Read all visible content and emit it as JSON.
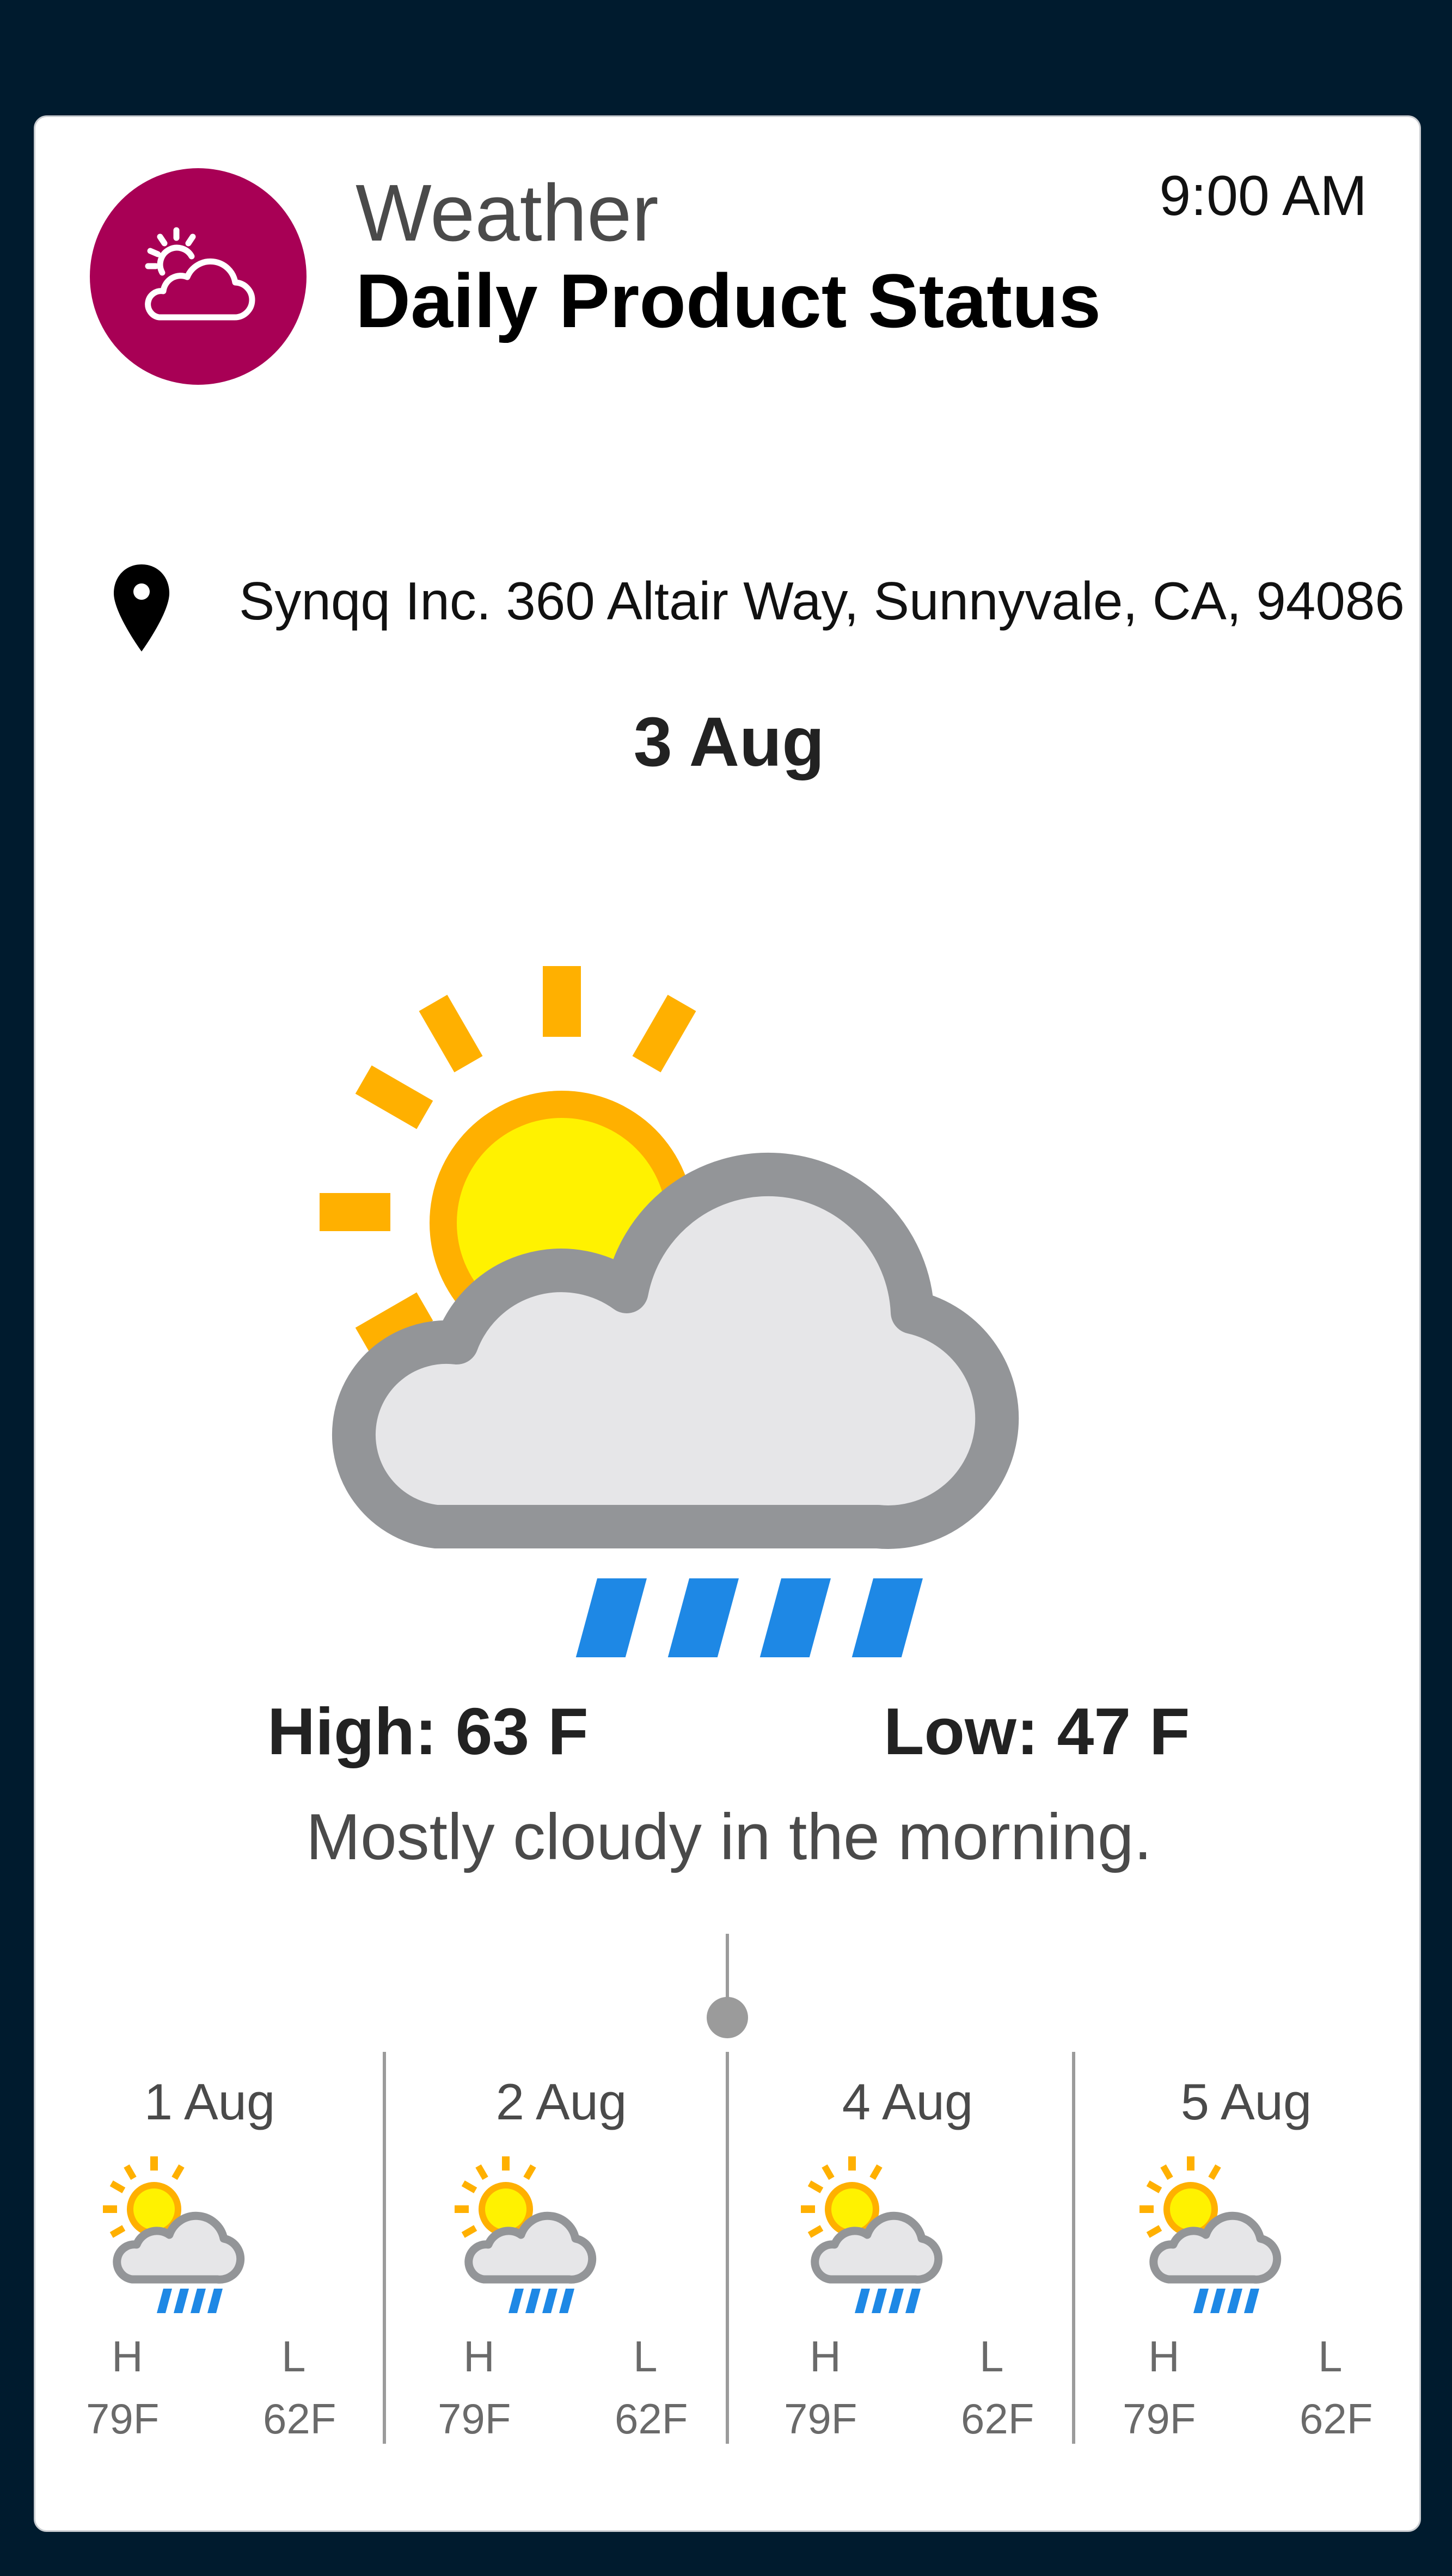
{
  "header": {
    "title": "Weather",
    "subtitle": "Daily Product Status",
    "time": "9:00 AM",
    "icon": "partly-sunny-cloud-icon",
    "brand_color": "#a80055"
  },
  "location": {
    "icon": "map-pin-icon",
    "address": "Synqq Inc. 360 Altair Way, Sunnyvale, CA, 94086"
  },
  "today": {
    "date": "3 Aug",
    "icon": "partly-cloudy-rain-icon",
    "high": "High: 63 F",
    "low": "Low: 47 F",
    "description": "Mostly cloudy in the morning."
  },
  "forecast": [
    {
      "date": "1 Aug",
      "icon": "partly-cloudy-rain-icon",
      "h_label": "H",
      "l_label": "L",
      "high": "79F",
      "low": "62F"
    },
    {
      "date": "2 Aug",
      "icon": "partly-cloudy-rain-icon",
      "h_label": "H",
      "l_label": "L",
      "high": "79F",
      "low": "62F"
    },
    {
      "date": "4 Aug",
      "icon": "partly-cloudy-rain-icon",
      "h_label": "H",
      "l_label": "L",
      "high": "79F",
      "low": "62F"
    },
    {
      "date": "5 Aug",
      "icon": "partly-cloudy-rain-icon",
      "h_label": "H",
      "l_label": "L",
      "high": "79F",
      "low": "62F"
    }
  ],
  "colors": {
    "background": "#001b2e",
    "sun_ray": "#ffb000",
    "sun_core": "#fff200",
    "cloud_fill": "#e6e6e8",
    "cloud_stroke": "#939598",
    "rain": "#1e88e5"
  }
}
